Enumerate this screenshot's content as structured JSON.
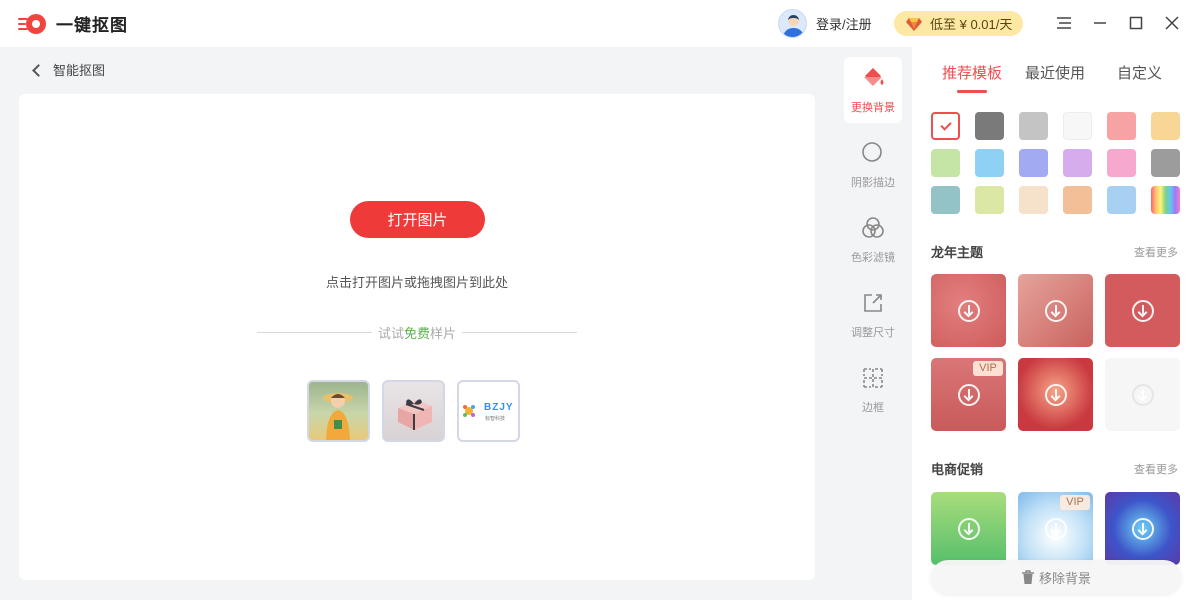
{
  "app": {
    "title": "一键抠图"
  },
  "header": {
    "login_label": "登录/注册",
    "vip_price": "低至 ¥ 0.01/天"
  },
  "main": {
    "back_label": "智能抠图",
    "open_button": "打开图片",
    "hint": "点击打开图片或拖拽图片到此处",
    "sample_prefix": "试试",
    "sample_free": "免费",
    "sample_suffix": "样片",
    "sample_logo_text": "BZJY",
    "sample_logo_sub": "标智科技"
  },
  "tools": [
    {
      "label": "更换背景",
      "icon": "paint-bucket-icon",
      "active": true
    },
    {
      "label": "阴影描边",
      "icon": "shadow-circle-icon",
      "active": false
    },
    {
      "label": "色彩滤镜",
      "icon": "color-filter-icon",
      "active": false
    },
    {
      "label": "调整尺寸",
      "icon": "resize-icon",
      "active": false
    },
    {
      "label": "边框",
      "icon": "border-grid-icon",
      "active": false
    }
  ],
  "panel": {
    "tabs": [
      "推荐模板",
      "最近使用",
      "自定义"
    ],
    "active_tab": 0,
    "swatches": [
      "#ffffff",
      "#7a7a7a",
      "#c4c4c4",
      "#f7f7f7",
      "#f7a3a3",
      "#f8d695",
      "#c5e5a6",
      "#8fd0f5",
      "#a2aaf1",
      "#d7acec",
      "#f6a8cf",
      "#9c9c9c",
      "#93c3c7",
      "#dbe8a3",
      "#f6e2ca",
      "#f2bf96",
      "#a7d0f3",
      "rainbow"
    ],
    "section1": {
      "title": "龙年主题",
      "more": "查看更多"
    },
    "section2": {
      "title": "电商促销",
      "more": "查看更多"
    },
    "vip_badge": "VIP",
    "remove_label": "移除背景"
  },
  "colors": {
    "accent": "#ef3a3a",
    "free_green": "#59b34a",
    "vip_gold": "#fde8a4"
  }
}
